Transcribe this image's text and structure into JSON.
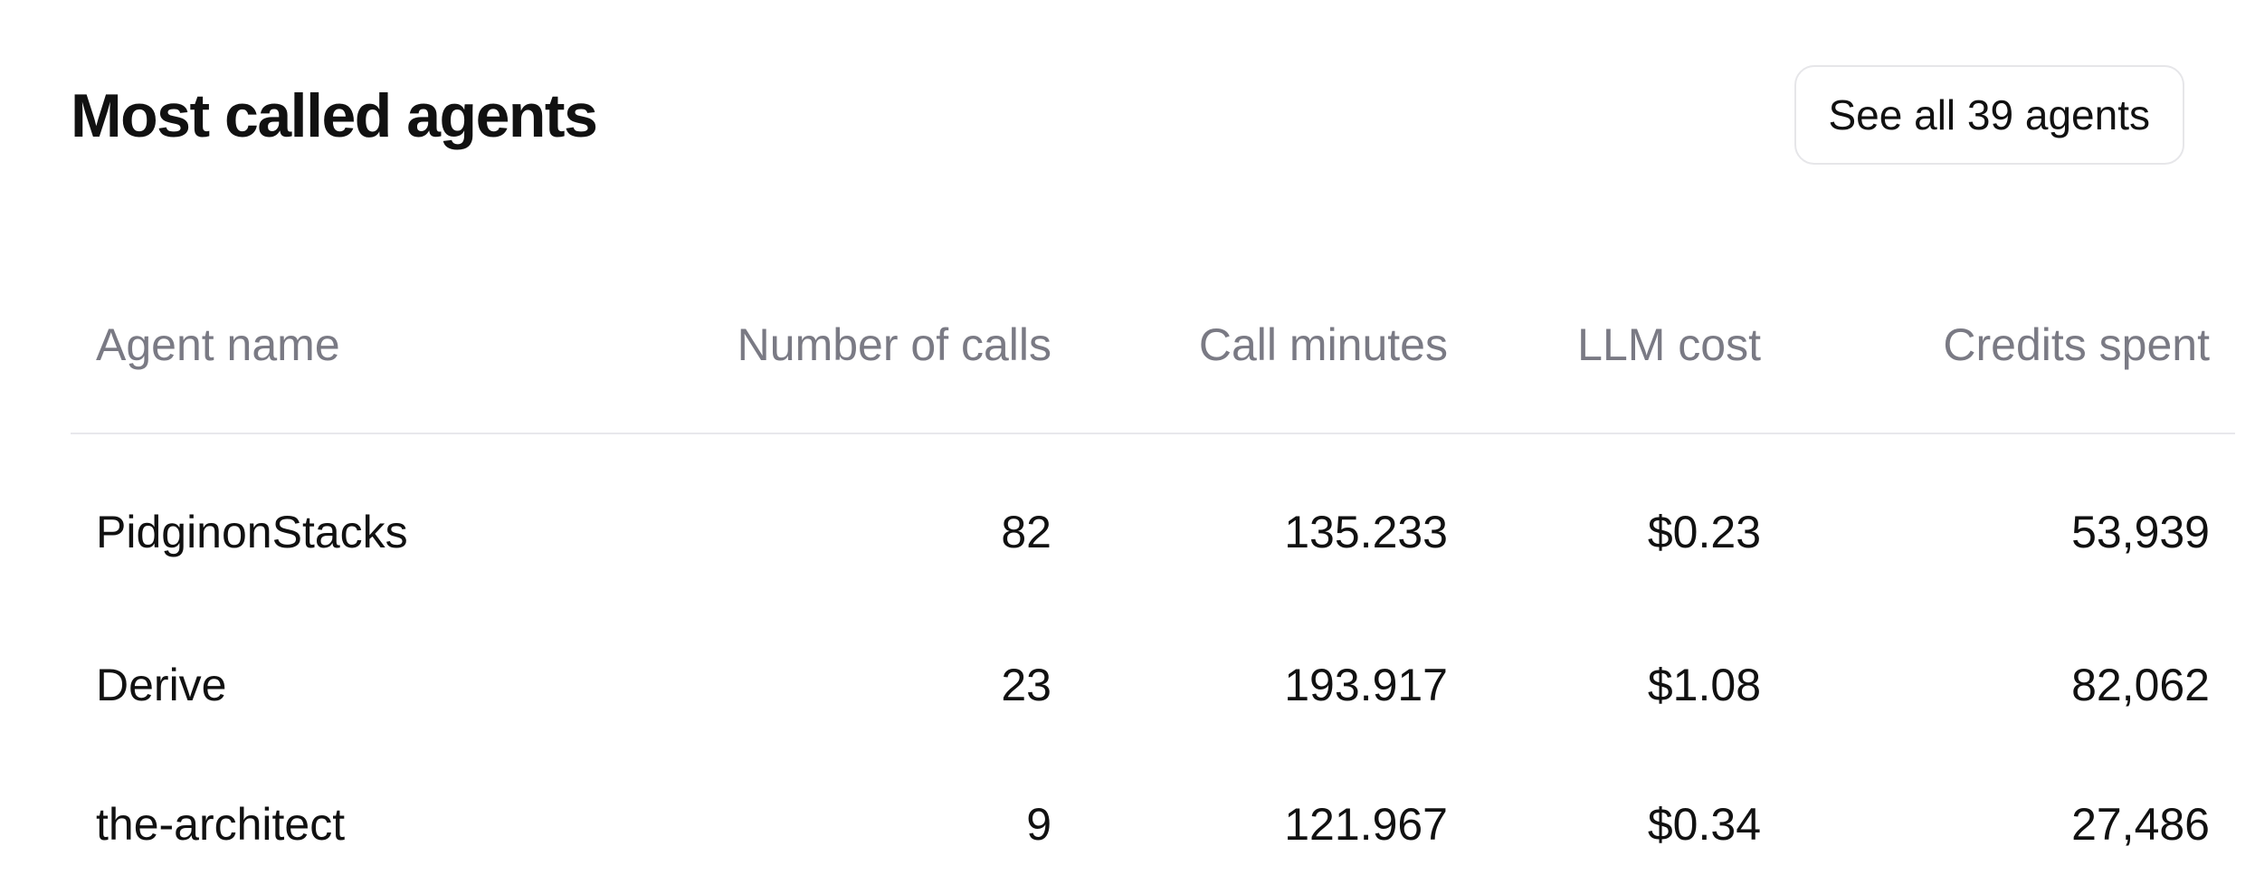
{
  "header": {
    "title": "Most called agents",
    "see_all_label": "See all 39 agents"
  },
  "table": {
    "columns": [
      "Agent name",
      "Number of calls",
      "Call minutes",
      "LLM cost",
      "Credits spent"
    ],
    "rows": [
      [
        "PidginonStacks",
        "82",
        "135.233",
        "$0.23",
        "53,939"
      ],
      [
        "Derive",
        "23",
        "193.917",
        "$1.08",
        "82,062"
      ],
      [
        "the-architect",
        "9",
        "121.967",
        "$0.34",
        "27,486"
      ]
    ]
  },
  "colors": {
    "text": "#111111",
    "header_text": "#7a7a84",
    "divider": "#e8e8ec",
    "button_border": "#e6e6e9",
    "background": "#ffffff"
  }
}
